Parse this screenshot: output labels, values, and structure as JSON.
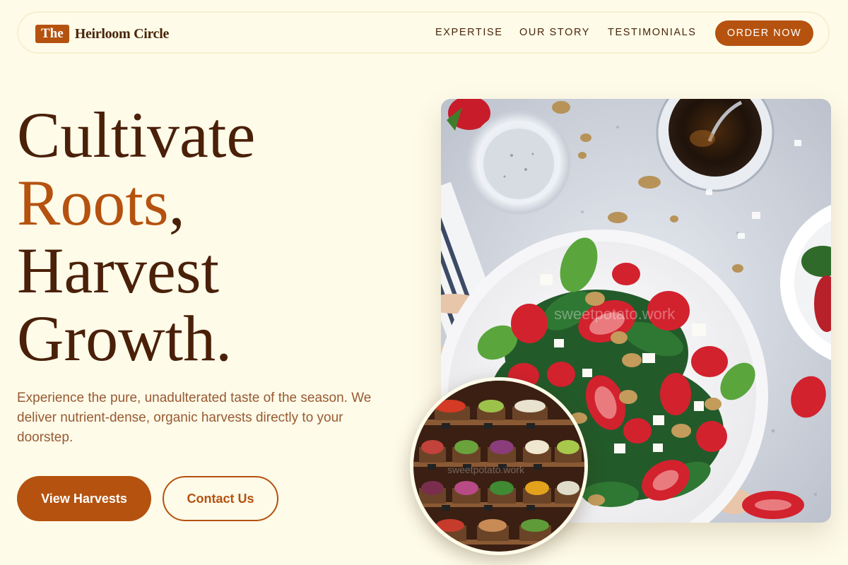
{
  "brand": {
    "badge": "The",
    "name": "Heirloom Circle"
  },
  "nav": {
    "items": [
      "EXPERTISE",
      "OUR STORY",
      "TESTIMONIALS"
    ],
    "cta": "ORDER NOW"
  },
  "hero": {
    "line1": "Cultivate",
    "line2_accent": "Roots",
    "line2_rest": ",",
    "line3": "Harvest",
    "line4": "Growth.",
    "description": "Experience the pure, unadulterated taste of the season. We deliver nutrient-dense, organic harvests directly to your doorstep.",
    "primary_button": "View Harvests",
    "secondary_button": "Contact Us"
  },
  "images": {
    "salad_watermark": "sweetpotato.work",
    "market_watermark": "sweetpotato.work"
  },
  "colors": {
    "background": "#fefbe9",
    "accent": "#b5520f",
    "heading": "#4a2009",
    "body_text": "#985a33"
  }
}
